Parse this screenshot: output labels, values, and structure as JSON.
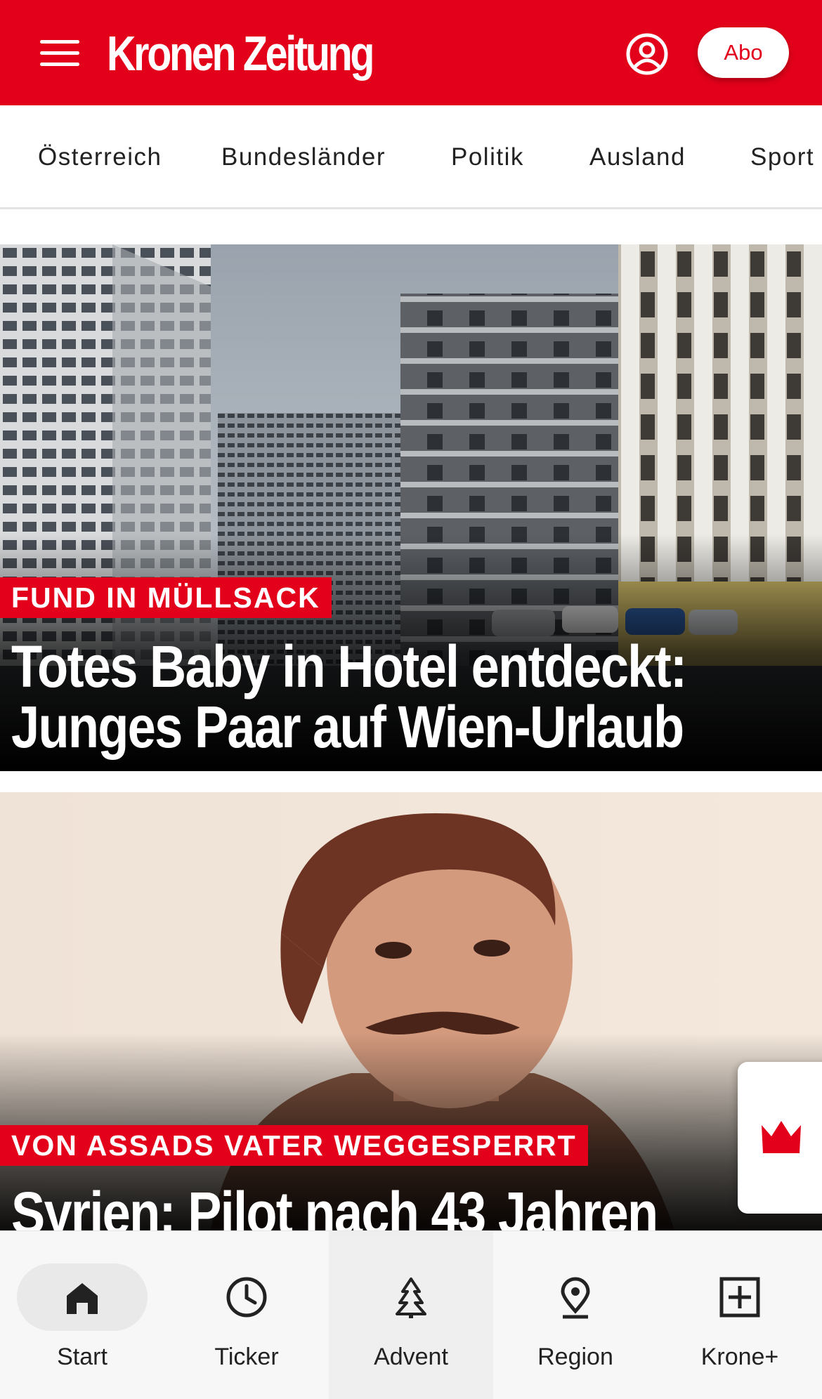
{
  "colors": {
    "brand_red": "#e2001a",
    "nav_background": "#f7f7f7",
    "text_dark": "#222222"
  },
  "header": {
    "logo": "Kronen Zeitung",
    "menu_icon": "hamburger-menu-icon",
    "user_icon": "user-account-icon",
    "abo_label": "Abo"
  },
  "tabs": [
    "Österreich",
    "Bundesländer",
    "Politik",
    "Ausland",
    "Sport"
  ],
  "articles": [
    {
      "kicker": "FUND IN MÜLLSACK",
      "headline_line1": "Totes Baby in Hotel entdeckt:",
      "headline_line2": "Junges Paar auf Wien-Urlaub",
      "image": "street-with-apartment-buildings-photo"
    },
    {
      "kicker": "VON ASSADS VATER WEGGESPERRT",
      "headline_line1": "Syrien: Pilot nach 43 Jahren",
      "image": "portrait-photo-of-man-with-mustache"
    }
  ],
  "floating_button": {
    "icon": "krone-crown-icon"
  },
  "bottom_nav": [
    {
      "label": "Start",
      "icon": "home-icon",
      "state": "selected"
    },
    {
      "label": "Ticker",
      "icon": "clock-icon"
    },
    {
      "label": "Advent",
      "icon": "christmas-tree-icon"
    },
    {
      "label": "Region",
      "icon": "location-pin-icon"
    },
    {
      "label": "Krone+",
      "icon": "plus-box-icon"
    }
  ]
}
